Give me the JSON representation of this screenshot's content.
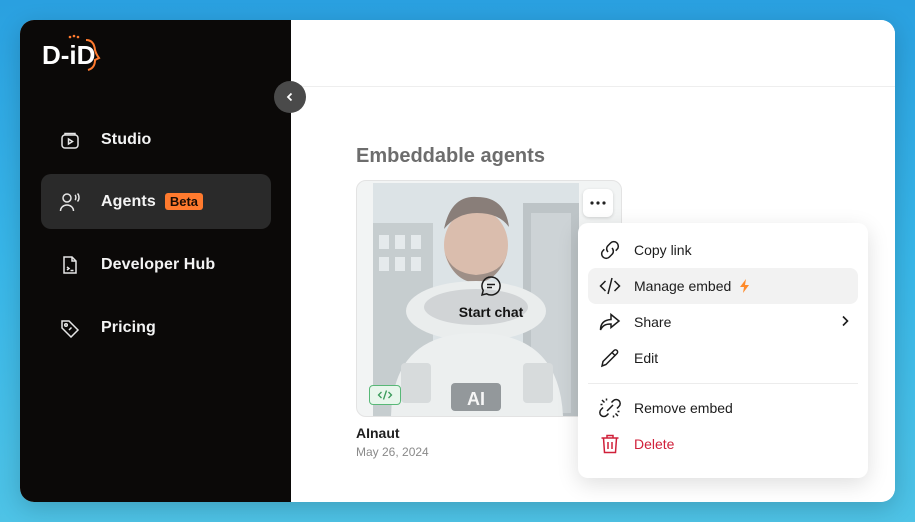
{
  "sidebar": {
    "logo_text": "D-iD",
    "items": [
      {
        "label": "Studio",
        "icon": "studio-icon"
      },
      {
        "label": "Agents",
        "icon": "agents-icon",
        "badge": "Beta",
        "active": true
      },
      {
        "label": "Developer Hub",
        "icon": "developer-hub-icon"
      },
      {
        "label": "Pricing",
        "icon": "pricing-tag-icon"
      }
    ],
    "collapse_icon": "chevron-left-icon"
  },
  "main": {
    "section_title": "Embeddable agents",
    "card": {
      "name": "AInaut",
      "date": "May 26, 2024",
      "start_chat": "Start chat",
      "suit_label": "AI",
      "embed_icon": "code-icon",
      "more_icon": "more-dots-icon"
    }
  },
  "context_menu": {
    "items": [
      {
        "label": "Copy link",
        "icon": "link-icon"
      },
      {
        "label": "Manage embed",
        "icon": "code-icon",
        "badge_icon": "bolt-icon",
        "hover": true
      },
      {
        "label": "Share",
        "icon": "share-icon",
        "submenu": true
      },
      {
        "label": "Edit",
        "icon": "pencil-icon"
      },
      {
        "label": "Remove embed",
        "icon": "unlink-icon"
      },
      {
        "label": "Delete",
        "icon": "trash-icon",
        "danger": true
      }
    ]
  },
  "colors": {
    "sidebar_bg": "#0b0908",
    "accent_orange": "#ff7a2e",
    "danger": "#d0203a",
    "embed_green": "#58b877"
  }
}
